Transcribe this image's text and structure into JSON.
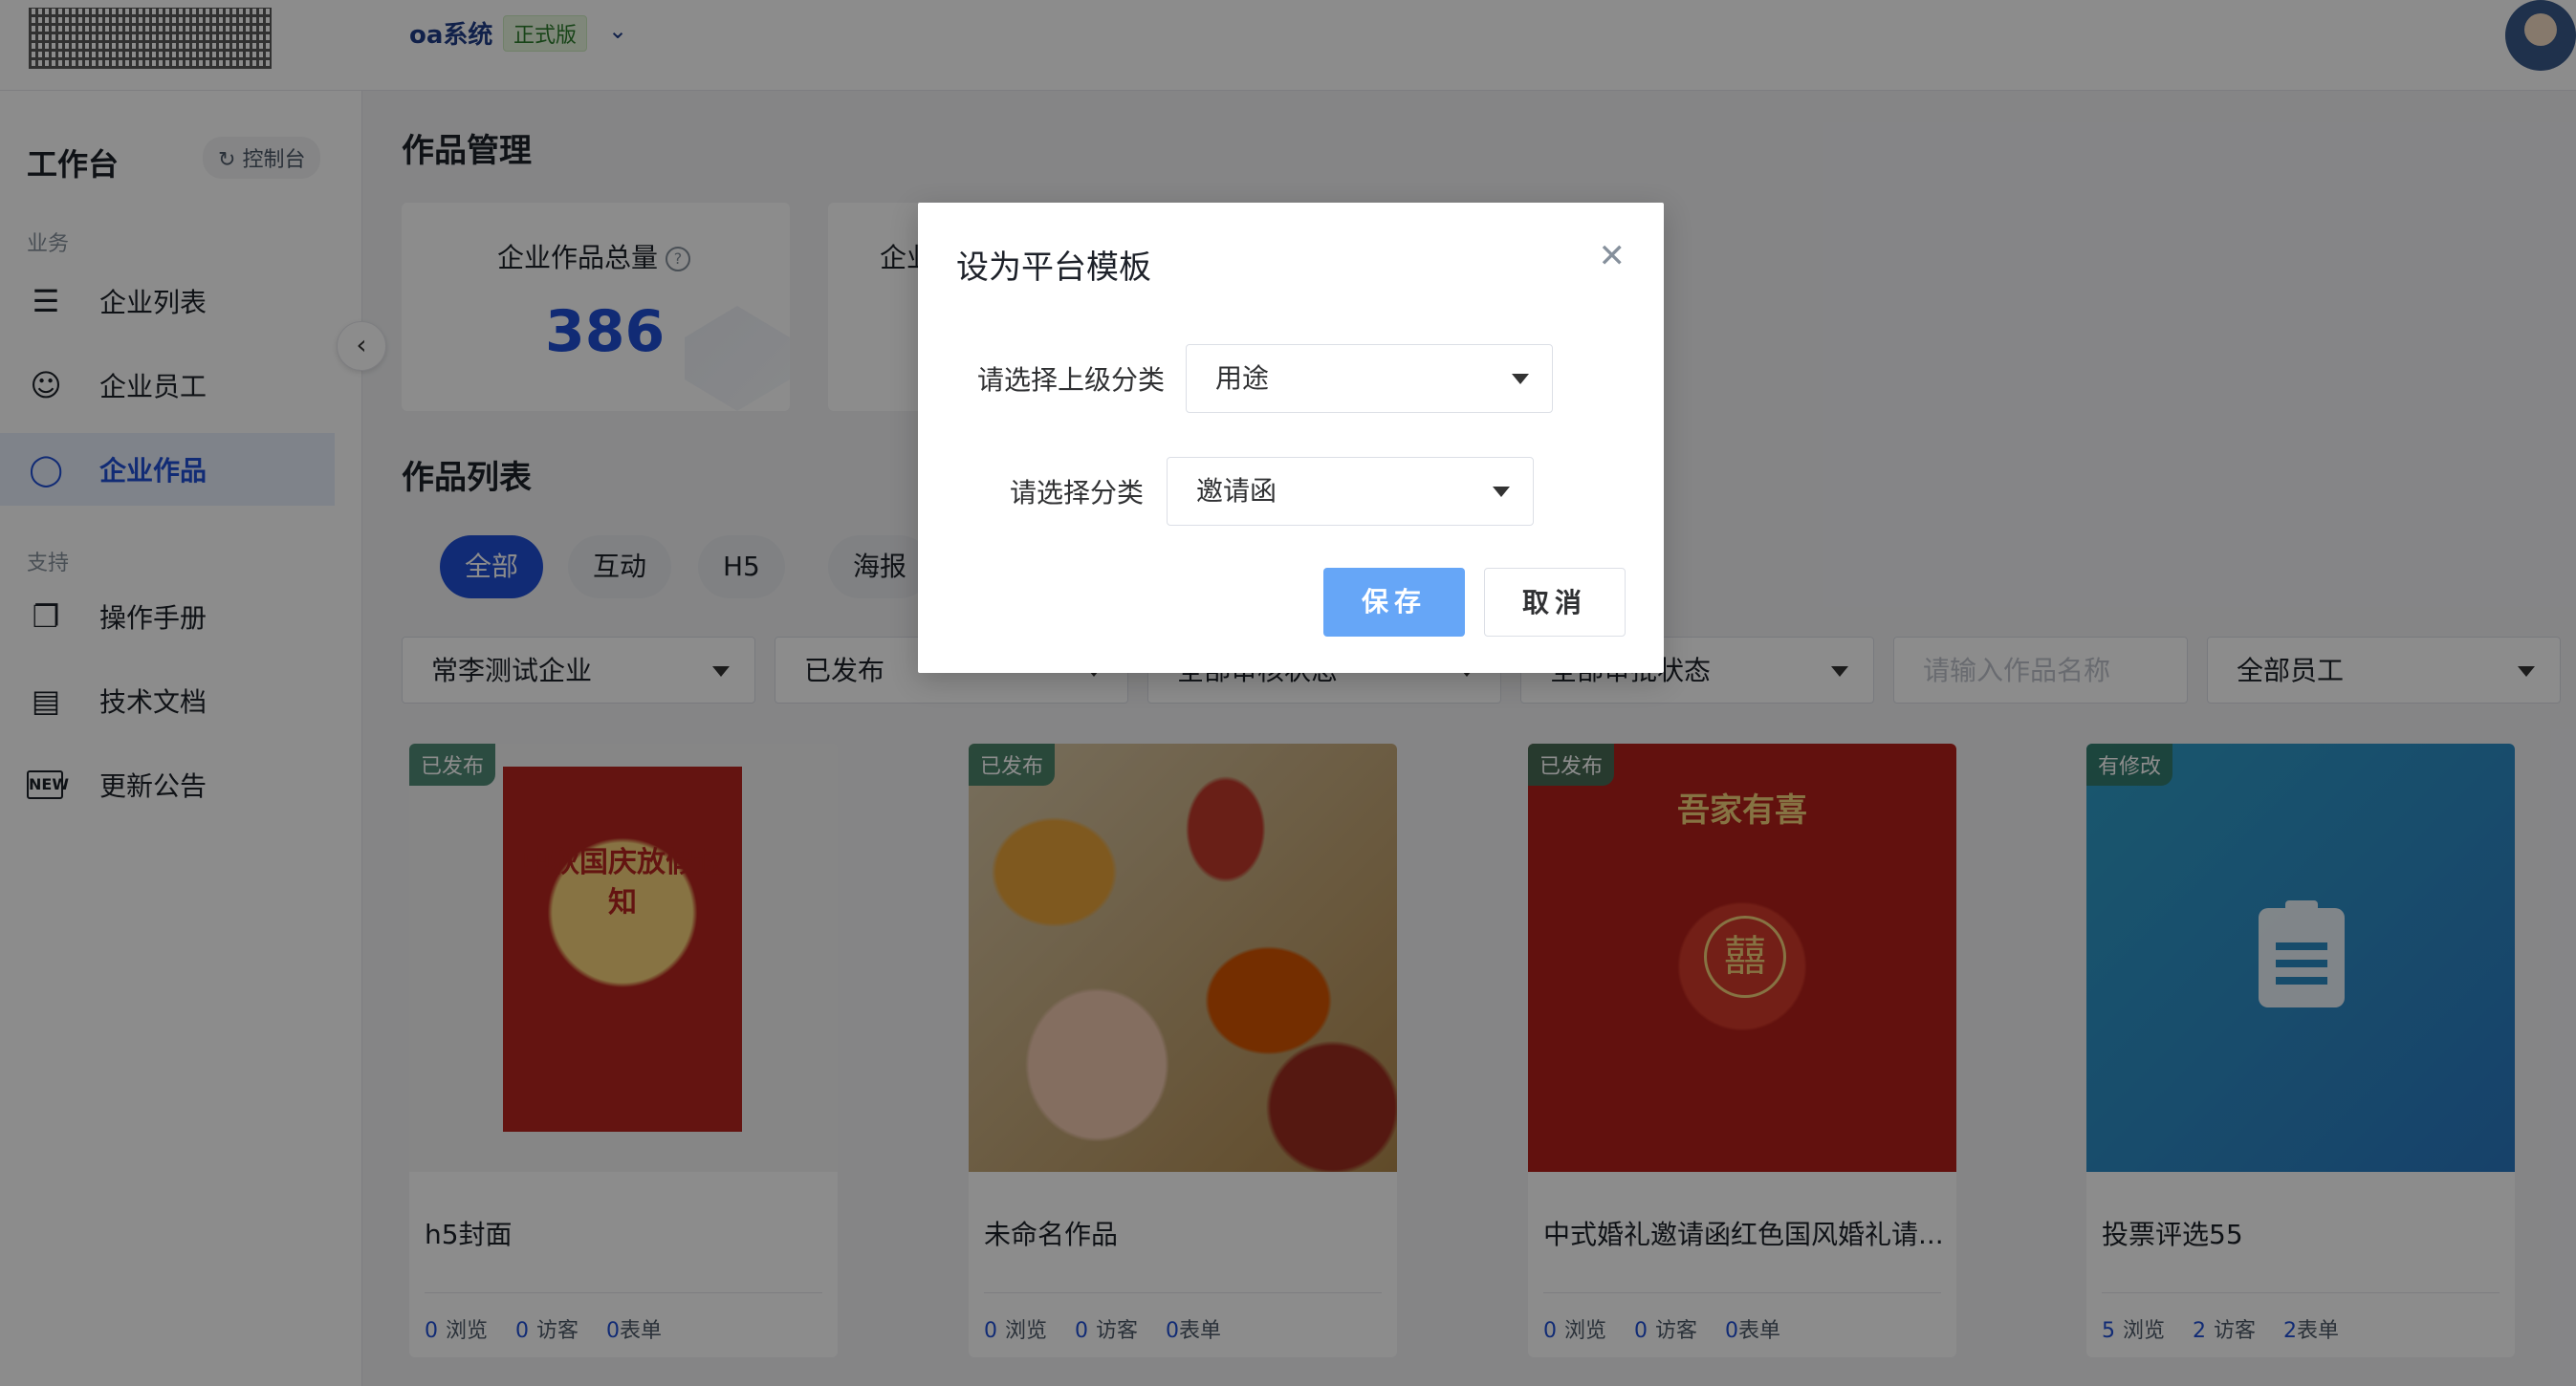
{
  "topbar": {
    "system_name": "oa系统",
    "edition_tag": "正式版"
  },
  "sidebar": {
    "title": "工作台",
    "console_label": "控制台",
    "groups": [
      {
        "label": "业务"
      },
      {
        "label": "支持"
      }
    ],
    "items": [
      {
        "label": "企业列表",
        "icon": "layers-icon"
      },
      {
        "label": "企业员工",
        "icon": "users-icon"
      },
      {
        "label": "企业作品",
        "icon": "lightbulb-icon",
        "active": true
      },
      {
        "label": "操作手册",
        "icon": "copy-icon"
      },
      {
        "label": "技术文档",
        "icon": "docs-icon"
      },
      {
        "label": "更新公告",
        "icon": "new-icon"
      }
    ]
  },
  "main": {
    "page_title": "作品管理",
    "stats": [
      {
        "label": "企业作品总量",
        "value": "386"
      },
      {
        "label": "企业"
      }
    ],
    "list_title": "作品列表",
    "tabs": [
      "全部",
      "互动",
      "H5",
      "海报"
    ],
    "filters": [
      {
        "value": "常李测试企业"
      },
      {
        "value": "已发布"
      },
      {
        "value": "全部审核状态"
      },
      {
        "value": "全部审批状态"
      },
      {
        "placeholder": "请输入作品名称"
      },
      {
        "value": "全部员工"
      }
    ],
    "cards": [
      {
        "badge": "已发布",
        "name": "h5封面",
        "views": "0",
        "views_label": "浏览",
        "visitors": "0",
        "visitors_label": "访客",
        "forms": "0",
        "forms_label": "表单",
        "poster_text": "中秋国庆放假通知"
      },
      {
        "badge": "已发布",
        "name": "未命名作品",
        "views": "0",
        "views_label": "浏览",
        "visitors": "0",
        "visitors_label": "访客",
        "forms": "0",
        "forms_label": "表单"
      },
      {
        "badge": "已发布",
        "name": "中式婚礼邀请函红色国风婚礼请...",
        "views": "0",
        "views_label": "浏览",
        "visitors": "0",
        "visitors_label": "访客",
        "forms": "0",
        "forms_label": "表单",
        "poster_text": "吾家有喜",
        "poster_glyph": "囍"
      },
      {
        "badge": "有修改",
        "name": "投票评选55",
        "views": "5",
        "views_label": "浏览",
        "visitors": "2",
        "visitors_label": "访客",
        "forms": "2",
        "forms_label": "表单"
      }
    ]
  },
  "dialog": {
    "title": "设为平台模板",
    "parent_label": "请选择上级分类",
    "parent_value": "用途",
    "category_label": "请选择分类",
    "category_value": "邀请函",
    "save_label": "保存",
    "cancel_label": "取消"
  },
  "colors": {
    "primary": "#1f4fd6",
    "save_button": "#66a6f7",
    "published_badge": "#347860"
  }
}
